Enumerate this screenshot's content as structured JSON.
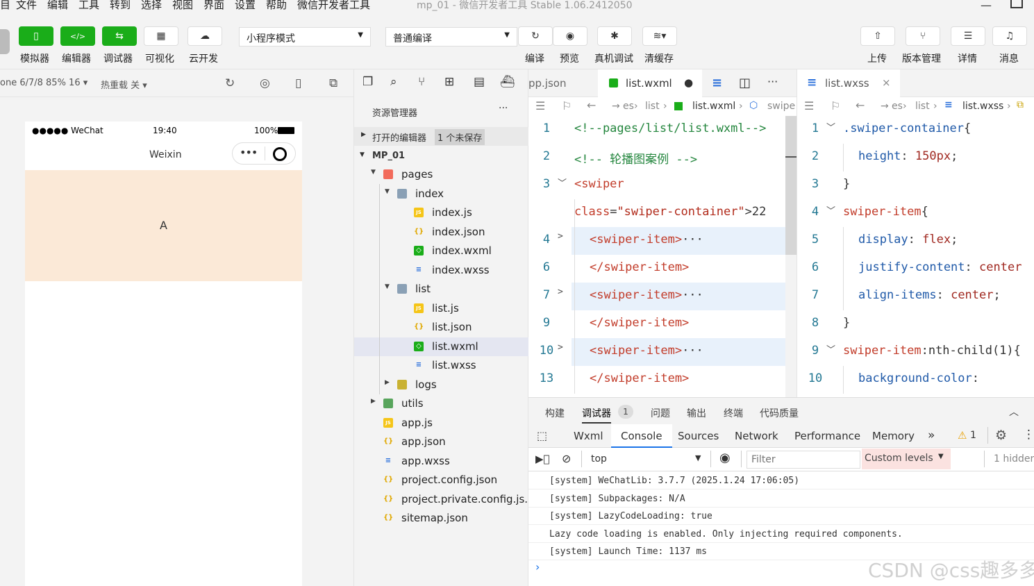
{
  "menu": {
    "items": [
      "目",
      "文件",
      "编辑",
      "工具",
      "转到",
      "选择",
      "视图",
      "界面",
      "设置",
      "帮助",
      "微信开发者工具"
    ],
    "title": "mp_01 - 微信开发者工具 Stable 1.06.2412050"
  },
  "toolbar": {
    "simulator": "模拟器",
    "editor": "编辑器",
    "debugger": "调试器",
    "visual": "可视化",
    "cloud": "云开发",
    "mode_select": "小程序模式",
    "compile_select": "普通编译",
    "compile": "编译",
    "preview": "预览",
    "real_debug": "真机调试",
    "clear_cache": "清缓存",
    "upload": "上传",
    "version": "版本管理",
    "details": "详情",
    "messages": "消息"
  },
  "simbar": {
    "device": "one 6/7/8 85% 16",
    "hot_reload": "热重载 关"
  },
  "phone": {
    "carrier": "●●●●● WeChat",
    "time": "19:40",
    "battery": "100%",
    "nav_title": "Weixin",
    "swiper_text": "A"
  },
  "explorer": {
    "title": "资源管理器",
    "open_editors": "打开的编辑器",
    "unsaved": "1 个未保存",
    "project": "MP_01",
    "tree": [
      {
        "label": "pages",
        "type": "folder-red",
        "depth": 1,
        "arrow": "▼"
      },
      {
        "label": "index",
        "type": "folder",
        "depth": 2,
        "arrow": "▼"
      },
      {
        "label": "index.js",
        "type": "js",
        "depth": 3,
        "arrow": ""
      },
      {
        "label": "index.json",
        "type": "json",
        "depth": 3,
        "arrow": ""
      },
      {
        "label": "index.wxml",
        "type": "wxml",
        "depth": 3,
        "arrow": ""
      },
      {
        "label": "index.wxss",
        "type": "wxss",
        "depth": 3,
        "arrow": ""
      },
      {
        "label": "list",
        "type": "folder",
        "depth": 2,
        "arrow": "▼"
      },
      {
        "label": "list.js",
        "type": "js",
        "depth": 3,
        "arrow": ""
      },
      {
        "label": "list.json",
        "type": "json",
        "depth": 3,
        "arrow": ""
      },
      {
        "label": "list.wxml",
        "type": "wxml",
        "depth": 3,
        "arrow": "",
        "selected": true
      },
      {
        "label": "list.wxss",
        "type": "wxss",
        "depth": 3,
        "arrow": ""
      },
      {
        "label": "logs",
        "type": "folder-yellow",
        "depth": 2,
        "arrow": "▶"
      },
      {
        "label": "utils",
        "type": "folder-green",
        "depth": 1,
        "arrow": "▶"
      },
      {
        "label": "app.js",
        "type": "js",
        "depth": 1,
        "arrow": ""
      },
      {
        "label": "app.json",
        "type": "json",
        "depth": 1,
        "arrow": ""
      },
      {
        "label": "app.wxss",
        "type": "wxss",
        "depth": 1,
        "arrow": ""
      },
      {
        "label": "project.config.json",
        "type": "json",
        "depth": 1,
        "arrow": ""
      },
      {
        "label": "project.private.config.js...",
        "type": "json",
        "depth": 1,
        "arrow": ""
      },
      {
        "label": "sitemap.json",
        "type": "json",
        "depth": 1,
        "arrow": ""
      }
    ]
  },
  "editor1": {
    "tab_prev": "pp.json",
    "tab_active": "list.wxml",
    "crumbs": [
      "es",
      "list",
      "list.wxml",
      "swipe"
    ],
    "lines": [
      {
        "n": "1",
        "parts": [
          [
            "cmt",
            "<!--pages/list/list.wxml-->"
          ]
        ],
        "fold": ""
      },
      {
        "n": "2",
        "parts": [
          [
            "cmt",
            "<!-- 轮播图案例 -->"
          ]
        ],
        "fold": ""
      },
      {
        "n": "3",
        "parts": [
          [
            "tag",
            "<swiper"
          ]
        ],
        "fold": "﹀"
      },
      {
        "n": "",
        "parts": [
          [
            "attr",
            "class"
          ],
          [
            "plain",
            "="
          ],
          [
            "str",
            "\"swiper-container\""
          ],
          [
            "plain",
            ">22"
          ]
        ],
        "fold": ""
      },
      {
        "n": "4",
        "parts": [
          [
            "tag",
            "<swiper-item>"
          ],
          [
            "plain",
            "···"
          ]
        ],
        "fold": ">",
        "hl": true,
        "indent": true
      },
      {
        "n": "6",
        "parts": [
          [
            "tag",
            "</swiper-item>"
          ]
        ],
        "fold": "",
        "indent": true
      },
      {
        "n": "7",
        "parts": [
          [
            "tag",
            "<swiper-item>"
          ],
          [
            "plain",
            "···"
          ]
        ],
        "fold": ">",
        "hl": true,
        "indent": true
      },
      {
        "n": "9",
        "parts": [
          [
            "tag",
            "</swiper-item>"
          ]
        ],
        "fold": "",
        "indent": true
      },
      {
        "n": "10",
        "parts": [
          [
            "tag",
            "<swiper-item>"
          ],
          [
            "plain",
            "···"
          ]
        ],
        "fold": ">",
        "hl": true,
        "indent": true
      },
      {
        "n": "13",
        "parts": [
          [
            "tag",
            "</swiper-item>"
          ]
        ],
        "fold": "",
        "indent": true
      }
    ]
  },
  "editor2": {
    "tab_active": "list.wxss",
    "crumbs": [
      "es",
      "list",
      "list.wxss"
    ],
    "lines": [
      {
        "n": "1",
        "parts": [
          [
            "prop",
            ".swiper-container"
          ],
          [
            "plain",
            "{"
          ]
        ],
        "fold": "﹀"
      },
      {
        "n": "2",
        "parts": [
          [
            "prop",
            "height"
          ],
          [
            "plain",
            ": "
          ],
          [
            "val",
            "150px"
          ],
          [
            "plain",
            ";"
          ]
        ],
        "fold": "",
        "indent": true
      },
      {
        "n": "3",
        "parts": [
          [
            "plain",
            "}"
          ]
        ],
        "fold": ""
      },
      {
        "n": "4",
        "parts": [
          [
            "sel-c",
            "swiper-item"
          ],
          [
            "plain",
            "{"
          ]
        ],
        "fold": "﹀"
      },
      {
        "n": "5",
        "parts": [
          [
            "prop",
            "display"
          ],
          [
            "plain",
            ": "
          ],
          [
            "val",
            "flex"
          ],
          [
            "plain",
            ";"
          ]
        ],
        "fold": "",
        "indent": true
      },
      {
        "n": "6",
        "parts": [
          [
            "prop",
            "justify-content"
          ],
          [
            "plain",
            ": "
          ],
          [
            "val",
            "center"
          ]
        ],
        "fold": "",
        "indent": true
      },
      {
        "n": "7",
        "parts": [
          [
            "prop",
            "align-items"
          ],
          [
            "plain",
            ": "
          ],
          [
            "val",
            "center"
          ],
          [
            "plain",
            ";"
          ]
        ],
        "fold": "",
        "indent": true
      },
      {
        "n": "8",
        "parts": [
          [
            "plain",
            "}"
          ]
        ],
        "fold": ""
      },
      {
        "n": "9",
        "parts": [
          [
            "sel-c",
            "swiper-item"
          ],
          [
            "plain",
            ":nth-child(1){"
          ]
        ],
        "fold": "﹀"
      },
      {
        "n": "10",
        "parts": [
          [
            "prop",
            "background-color"
          ],
          [
            "plain",
            ":"
          ]
        ],
        "fold": "",
        "indent": true
      }
    ]
  },
  "devtools": {
    "top_tabs": [
      "构建",
      "调试器",
      "问题",
      "输出",
      "终端",
      "代码质量"
    ],
    "debugger_badge": "1",
    "tabs": [
      "Wxml",
      "Console",
      "Sources",
      "Network",
      "Performance",
      "Memory"
    ],
    "more": "»",
    "warn_count": "1",
    "context": "top",
    "filter_placeholder": "Filter",
    "levels": "Custom levels",
    "hidden": "1 hidden",
    "console": [
      "[system] WeChatLib: 3.7.7 (2025.1.24 17:06:05)",
      "[system] Subpackages: N/A",
      "[system] LazyCodeLoading: true",
      "Lazy code loading is enabled. Only injecting required components.",
      "[system] Launch Time: 1137 ms"
    ],
    "prompt": "›"
  },
  "watermark": "CSDN @css趣多多",
  "colors": {
    "green": "#1aad19",
    "swiper_bg": "#fbe9d7",
    "link_blue": "#1a73e8"
  }
}
